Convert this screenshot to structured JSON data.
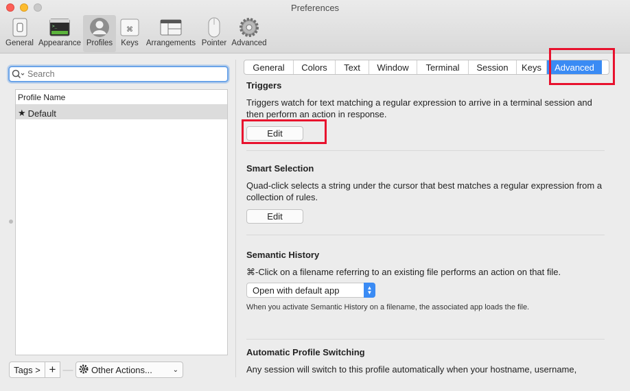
{
  "window": {
    "title": "Preferences"
  },
  "toolbar": {
    "items": [
      {
        "label": "General",
        "icon": "general-switch-icon"
      },
      {
        "label": "Appearance",
        "icon": "appearance-window-icon"
      },
      {
        "label": "Profiles",
        "icon": "profiles-person-icon"
      },
      {
        "label": "Keys",
        "icon": "keys-command-icon"
      },
      {
        "label": "Arrangements",
        "icon": "arrangements-icon"
      },
      {
        "label": "Pointer",
        "icon": "pointer-mouse-icon"
      },
      {
        "label": "Advanced",
        "icon": "advanced-gear-icon"
      }
    ],
    "active": "Profiles"
  },
  "search": {
    "placeholder": "Search",
    "value": ""
  },
  "profiles": {
    "header": "Profile Name",
    "rows": [
      {
        "name": "Default",
        "default_marker": "★"
      }
    ]
  },
  "bottom_bar": {
    "tags_label": "Tags >",
    "add_label": "+",
    "remove_label": "—",
    "other_actions_label": "Other Actions..."
  },
  "tabs": {
    "items": [
      "General",
      "Colors",
      "Text",
      "Window",
      "Terminal",
      "Session",
      "Keys",
      "Advanced"
    ],
    "active": "Advanced"
  },
  "sections": {
    "triggers": {
      "title": "Triggers",
      "desc": "Triggers watch for text matching a regular expression to arrive in a terminal session and then perform an action in response.",
      "button": "Edit"
    },
    "smart_selection": {
      "title": "Smart Selection",
      "desc": "Quad-click selects a string under the cursor that best matches a regular expression from a collection of rules.",
      "button": "Edit"
    },
    "semantic_history": {
      "title": "Semantic History",
      "desc": "⌘-Click on a filename referring to an existing file performs an action on that file.",
      "select_value": "Open with default app",
      "note": "When you activate Semantic History on a filename, the associated app loads the file."
    },
    "auto_profile": {
      "title": "Automatic Profile Switching",
      "desc": "Any session will switch to this profile automatically when your hostname, username,"
    }
  },
  "colors": {
    "accent": "#3a8bf4",
    "highlight_box": "#e8112d"
  }
}
